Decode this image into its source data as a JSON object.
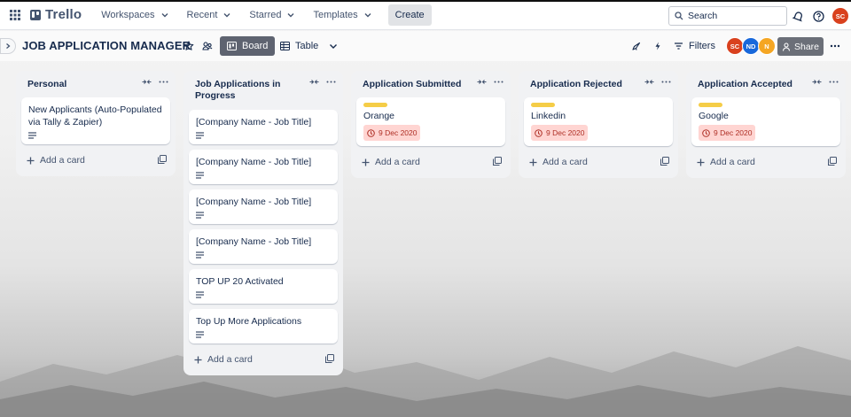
{
  "topnav": {
    "logo_text": "Trello",
    "workspaces_label": "Workspaces",
    "recent_label": "Recent",
    "starred_label": "Starred",
    "templates_label": "Templates",
    "create_label": "Create",
    "search_placeholder": "Search",
    "user_avatar": {
      "initials": "SC",
      "color": "#d9411e"
    }
  },
  "board": {
    "title": "JOB APPLICATION MANAGER",
    "board_view_label": "Board",
    "table_view_label": "Table",
    "filters_label": "Filters",
    "share_label": "Share",
    "members": [
      {
        "initials": "SC",
        "color": "#d9411e"
      },
      {
        "initials": "ND",
        "color": "#1868db"
      },
      {
        "initials": "N",
        "color": "#f5a623"
      }
    ]
  },
  "lists": [
    {
      "title": "Personal",
      "add_card_label": "Add a card",
      "cards": [
        {
          "title": "New Applicants (Auto-Populated via Tally & Zapier)",
          "has_description": true
        }
      ]
    },
    {
      "title": "Job Applications in Progress",
      "add_card_label": "Add a card",
      "cards": [
        {
          "title": "[Company Name - Job Title]",
          "has_description": true
        },
        {
          "title": "[Company Name - Job Title]",
          "has_description": true
        },
        {
          "title": "[Company Name - Job Title]",
          "has_description": true
        },
        {
          "title": "[Company Name - Job Title]",
          "has_description": true
        },
        {
          "title": "TOP UP 20 Activated",
          "has_description": true
        },
        {
          "title": "Top Up More Applications",
          "has_description": true
        }
      ]
    },
    {
      "title": "Application Submitted",
      "add_card_label": "Add a card",
      "cards": [
        {
          "title": "Orange",
          "label_color": "#f5cd47",
          "due": "9 Dec 2020"
        }
      ]
    },
    {
      "title": "Application Rejected",
      "add_card_label": "Add a card",
      "cards": [
        {
          "title": "Linkedin",
          "label_color": "#f5cd47",
          "due": "9 Dec 2020"
        }
      ]
    },
    {
      "title": "Application Accepted",
      "add_card_label": "Add a card",
      "cards": [
        {
          "title": "Google",
          "label_color": "#f5cd47",
          "due": "9 Dec 2020"
        }
      ]
    }
  ]
}
